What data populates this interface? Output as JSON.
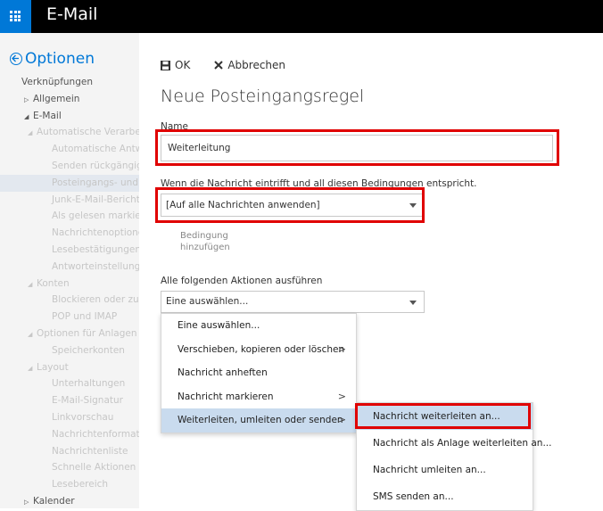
{
  "app": {
    "title": "E-Mail"
  },
  "sidebar": {
    "header": "Optionen",
    "items": [
      {
        "label": "Verknüpfungen",
        "tone": "dark",
        "indent": 0,
        "arrow": ""
      },
      {
        "label": "Allgemein",
        "tone": "dark",
        "indent": 1,
        "arrow": "▷"
      },
      {
        "label": "E-Mail",
        "tone": "dark",
        "indent": 1,
        "arrow": "◢"
      },
      {
        "label": "Automatische Verarbeitung",
        "tone": "light",
        "indent": 2,
        "arrow": "◢"
      },
      {
        "label": "Automatische Antworten",
        "tone": "light",
        "indent": 3,
        "arrow": ""
      },
      {
        "label": "Senden rückgängig machen",
        "tone": "light",
        "indent": 3,
        "arrow": ""
      },
      {
        "label": "Posteingangs- und Aufräumregeln",
        "tone": "light",
        "indent": 3,
        "arrow": "",
        "selected": true
      },
      {
        "label": "Junk-E-Mail-Berichterstattung",
        "tone": "light",
        "indent": 3,
        "arrow": ""
      },
      {
        "label": "Als gelesen markieren",
        "tone": "light",
        "indent": 3,
        "arrow": ""
      },
      {
        "label": "Nachrichtenoptionen",
        "tone": "light",
        "indent": 3,
        "arrow": ""
      },
      {
        "label": "Lesebestätigungen",
        "tone": "light",
        "indent": 3,
        "arrow": ""
      },
      {
        "label": "Antworteinstellungen",
        "tone": "light",
        "indent": 3,
        "arrow": ""
      },
      {
        "label": "Konten",
        "tone": "light",
        "indent": 2,
        "arrow": "◢"
      },
      {
        "label": "Blockieren oder zulassen",
        "tone": "light",
        "indent": 3,
        "arrow": ""
      },
      {
        "label": "POP und IMAP",
        "tone": "light",
        "indent": 3,
        "arrow": ""
      },
      {
        "label": "Optionen für Anlagen",
        "tone": "light",
        "indent": 2,
        "arrow": "◢"
      },
      {
        "label": "Speicherkonten",
        "tone": "light",
        "indent": 3,
        "arrow": ""
      },
      {
        "label": "Layout",
        "tone": "light",
        "indent": 2,
        "arrow": "◢"
      },
      {
        "label": "Unterhaltungen",
        "tone": "light",
        "indent": 3,
        "arrow": ""
      },
      {
        "label": "E-Mail-Signatur",
        "tone": "light",
        "indent": 3,
        "arrow": ""
      },
      {
        "label": "Linkvorschau",
        "tone": "light",
        "indent": 3,
        "arrow": ""
      },
      {
        "label": "Nachrichtenformat",
        "tone": "light",
        "indent": 3,
        "arrow": ""
      },
      {
        "label": "Nachrichtenliste",
        "tone": "light",
        "indent": 3,
        "arrow": ""
      },
      {
        "label": "Schnelle Aktionen",
        "tone": "light",
        "indent": 3,
        "arrow": ""
      },
      {
        "label": "Lesebereich",
        "tone": "light",
        "indent": 3,
        "arrow": ""
      },
      {
        "label": "Kalender",
        "tone": "dark",
        "indent": 1,
        "arrow": "▷"
      }
    ]
  },
  "toolbar": {
    "ok_label": "OK",
    "cancel_label": "Abbrechen"
  },
  "form": {
    "title": "Neue Posteingangsregel",
    "name_label": "Name",
    "name_value": "Weiterleitung",
    "condition_label": "Wenn die Nachricht eintrifft und all diesen Bedingungen entspricht.",
    "condition_value": "[Auf alle Nachrichten anwenden]",
    "add_condition_line1": "Bedingung",
    "add_condition_line2": "hinzufügen",
    "action_label": "Alle folgenden Aktionen ausführen",
    "action_value": "Eine auswählen..."
  },
  "action_menu": [
    {
      "label": "Eine auswählen...",
      "submenu": false
    },
    {
      "label": "Verschieben, kopieren oder löschen",
      "submenu": true
    },
    {
      "label": "Nachricht anheften",
      "submenu": false
    },
    {
      "label": "Nachricht markieren",
      "submenu": true
    },
    {
      "label": "Weiterleiten, umleiten oder senden",
      "submenu": true,
      "active": true
    }
  ],
  "forward_submenu": [
    {
      "label": "Nachricht weiterleiten an...",
      "active": true
    },
    {
      "label": "Nachricht als Anlage weiterleiten an..."
    },
    {
      "label": "Nachricht umleiten an..."
    },
    {
      "label": "SMS senden an..."
    }
  ],
  "colors": {
    "accent": "#0078d7",
    "highlight": "#e00000",
    "topbar": "#000000",
    "menu_active": "#c9dbee"
  }
}
